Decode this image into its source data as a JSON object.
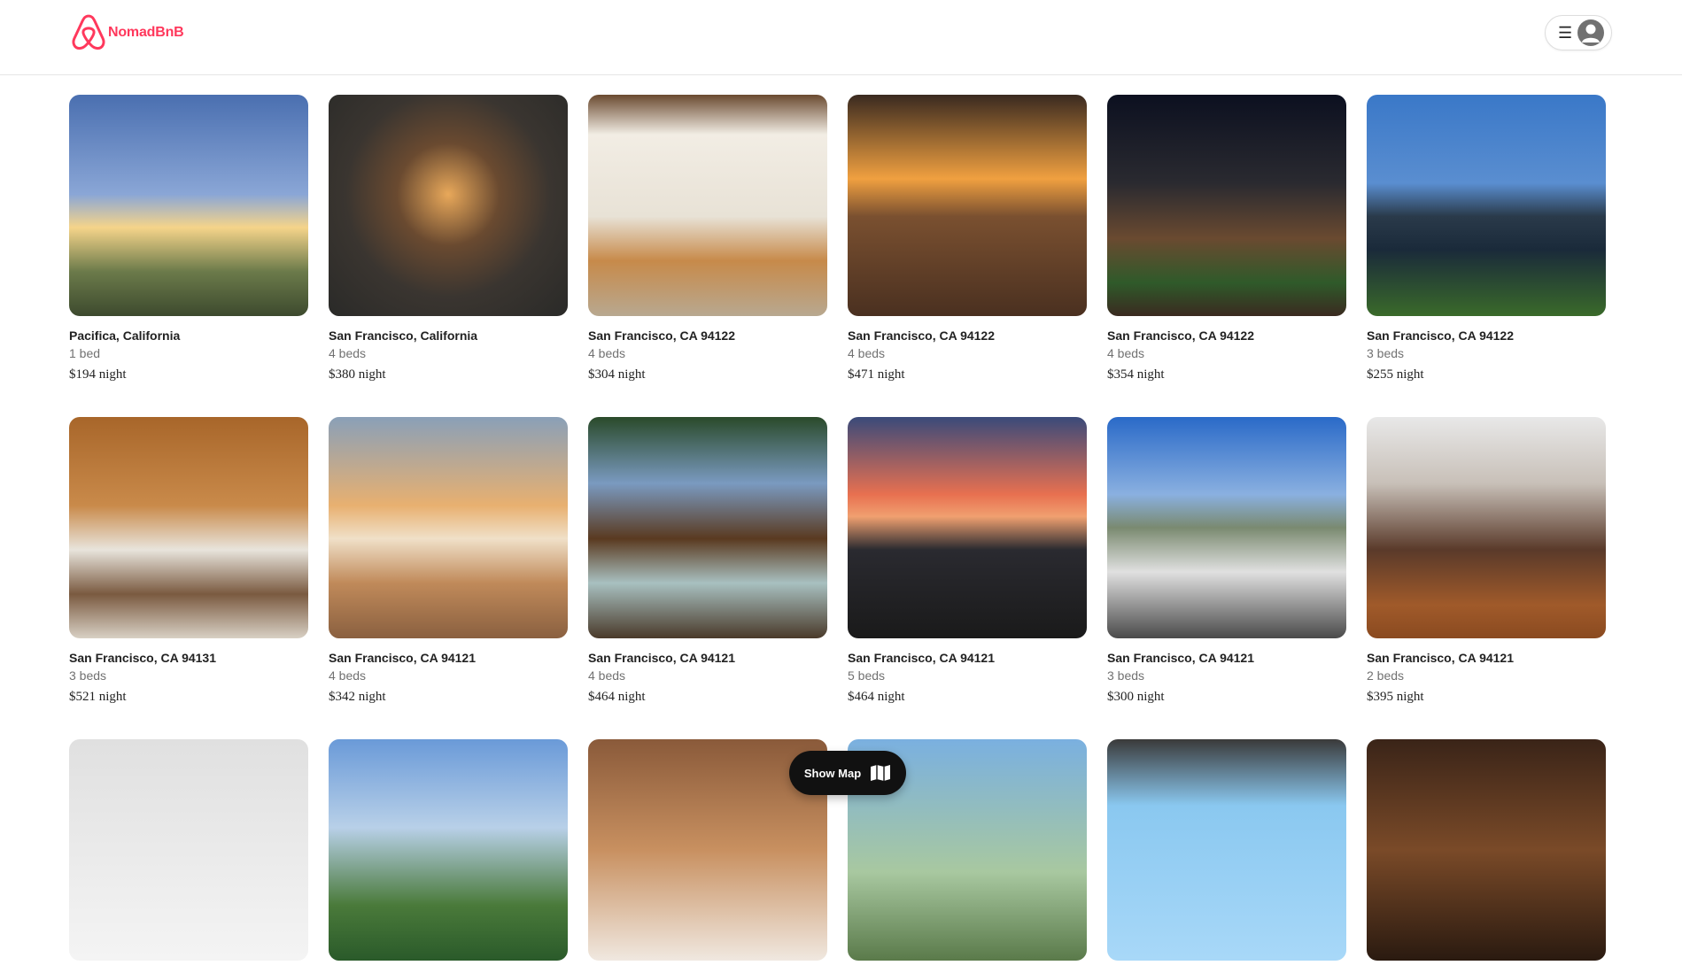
{
  "brand": {
    "name": "NomadBnB",
    "logo_icon": "airbnb-logo-icon",
    "color": "#ff385c"
  },
  "header": {
    "menu_icon": "hamburger-menu-icon",
    "avatar_icon": "user-avatar-icon"
  },
  "listings": [
    {
      "location": "Pacifica, California",
      "beds": "1 bed",
      "price": "$194 night"
    },
    {
      "location": "San Francisco, California",
      "beds": "4 beds",
      "price": "$380 night"
    },
    {
      "location": "San Francisco, CA 94122",
      "beds": "4 beds",
      "price": "$304 night"
    },
    {
      "location": "San Francisco, CA 94122",
      "beds": "4 beds",
      "price": "$471 night"
    },
    {
      "location": "San Francisco, CA 94122",
      "beds": "4 beds",
      "price": "$354 night"
    },
    {
      "location": "San Francisco, CA 94122",
      "beds": "3 beds",
      "price": "$255 night"
    },
    {
      "location": "San Francisco, CA 94131",
      "beds": "3 beds",
      "price": "$521 night"
    },
    {
      "location": "San Francisco, CA 94121",
      "beds": "4 beds",
      "price": "$342 night"
    },
    {
      "location": "San Francisco, CA 94121",
      "beds": "4 beds",
      "price": "$464 night"
    },
    {
      "location": "San Francisco, CA 94121",
      "beds": "5 beds",
      "price": "$464 night"
    },
    {
      "location": "San Francisco, CA 94121",
      "beds": "3 beds",
      "price": "$300 night"
    },
    {
      "location": "San Francisco, CA 94121",
      "beds": "2 beds",
      "price": "$395 night"
    },
    {
      "location": "",
      "beds": "",
      "price": ""
    },
    {
      "location": "",
      "beds": "",
      "price": ""
    },
    {
      "location": "",
      "beds": "",
      "price": ""
    },
    {
      "location": "",
      "beds": "",
      "price": ""
    },
    {
      "location": "",
      "beds": "",
      "price": ""
    },
    {
      "location": "",
      "beds": "",
      "price": ""
    }
  ],
  "map_button": {
    "label": "Show Map",
    "icon": "map-icon"
  }
}
